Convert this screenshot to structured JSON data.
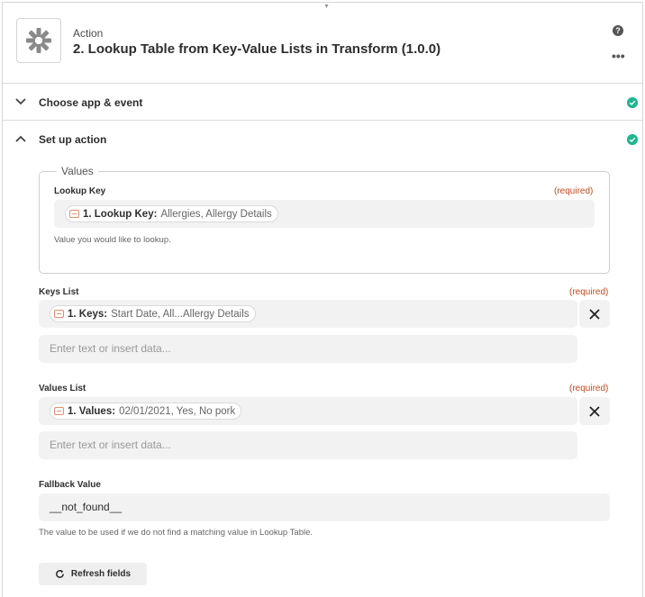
{
  "header": {
    "kicker": "Action",
    "title": "2. Lookup Table from Key-Value Lists in Transform (1.0.0)",
    "help_glyph": "?",
    "more_glyph": "•••",
    "app_icon": "transform-asterisk-icon"
  },
  "sections": [
    {
      "label": "Choose app & event",
      "state": "collapsed",
      "complete": true
    },
    {
      "label": "Set up action",
      "state": "expanded",
      "complete": true
    }
  ],
  "values_group": {
    "legend": "Values",
    "lookup_key": {
      "label": "Lookup Key",
      "required": "(required)",
      "pill_key": "1. Lookup Key:",
      "pill_value": "Allergies, Allergy Details",
      "help": "Value you would like to lookup."
    }
  },
  "keys_list": {
    "label": "Keys List",
    "required": "(required)",
    "pill_key": "1. Keys:",
    "pill_value": "Start Date, All...Allergy Details",
    "placeholder": "Enter text or insert data..."
  },
  "values_list": {
    "label": "Values List",
    "required": "(required)",
    "pill_key": "1. Values:",
    "pill_value": "02/01/2021, Yes, No pork",
    "placeholder": "Enter text or insert data..."
  },
  "fallback": {
    "label": "Fallback Value",
    "value": "__not_found__",
    "help": "The value to be used if we do not find a matching value in Lookup Table."
  },
  "refresh_label": "Refresh fields",
  "colors": {
    "accent_required": "#c8481c",
    "success": "#1fb58f",
    "pill_icon": "#e98b6a"
  }
}
